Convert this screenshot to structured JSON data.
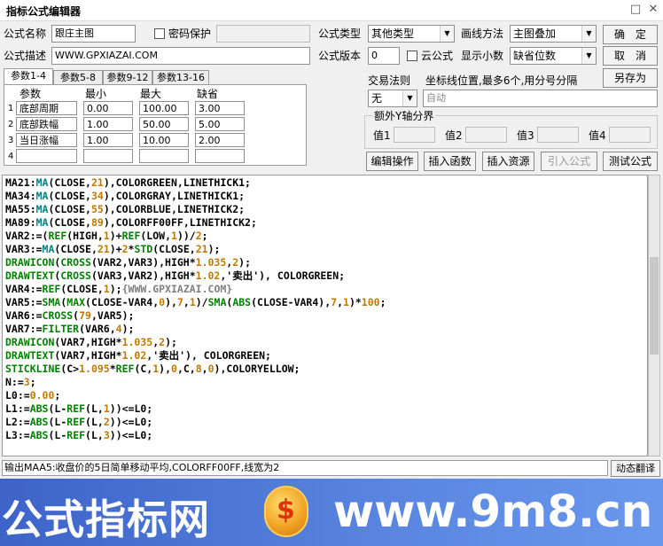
{
  "window": {
    "title": "指标公式编辑器",
    "restore_glyph": "□",
    "close_glyph": "✕"
  },
  "header": {
    "name_label": "公式名称",
    "name_value": "跟庄主图",
    "password_label": "密码保护",
    "desc_label": "公式描述",
    "desc_value": "WWW.GPXIAZAI.COM",
    "type_label": "公式类型",
    "type_value": "其他类型",
    "draw_label": "画线方法",
    "draw_value": "主图叠加",
    "version_label": "公式版本",
    "version_value": "0",
    "cloud_label": "云公式",
    "decimals_label": "显示小数",
    "decimals_value": "缺省位数",
    "ok_label": "确　定",
    "cancel_label": "取　消",
    "saveas_label": "另存为"
  },
  "params": {
    "tabs": [
      "参数1-4",
      "参数5-8",
      "参数9-12",
      "参数13-16"
    ],
    "columns": [
      "参数",
      "最小",
      "最大",
      "缺省"
    ],
    "rows": [
      {
        "idx": "1",
        "name": "底部周期",
        "min": "0.00",
        "max": "100.00",
        "def": "3.00"
      },
      {
        "idx": "2",
        "name": "底部跌幅",
        "min": "1.00",
        "max": "50.00",
        "def": "5.00"
      },
      {
        "idx": "3",
        "name": "当日涨幅",
        "min": "1.00",
        "max": "10.00",
        "def": "2.00"
      },
      {
        "idx": "4",
        "name": "",
        "min": "",
        "max": "",
        "def": ""
      }
    ]
  },
  "trade": {
    "rule_label": "交易法则",
    "rule_value": "无",
    "axis_label": "坐标线位置,最多6个,用分号分隔",
    "axis_value": "自动",
    "group_label": "额外Y轴分界",
    "values": [
      "值1",
      "值2",
      "值3",
      "值4"
    ]
  },
  "actions": [
    "编辑操作",
    "插入函数",
    "插入资源",
    "引入公式",
    "测试公式"
  ],
  "code_lines": [
    [
      [
        "MA21:",
        "tx"
      ],
      [
        "MA",
        "fn"
      ],
      [
        "(CLOSE,",
        "tx"
      ],
      [
        "21",
        "num"
      ],
      [
        "),COLORGREEN,LINETHICK1;",
        "tx"
      ]
    ],
    [
      [
        "MA34:",
        "tx"
      ],
      [
        "MA",
        "fn"
      ],
      [
        "(CLOSE,",
        "tx"
      ],
      [
        "34",
        "num"
      ],
      [
        "),COLORGRAY,LINETHICK1;",
        "tx"
      ]
    ],
    [
      [
        "MA55:",
        "tx"
      ],
      [
        "MA",
        "fn"
      ],
      [
        "(CLOSE,",
        "tx"
      ],
      [
        "55",
        "num"
      ],
      [
        "),COLORBLUE,LINETHICK2;",
        "tx"
      ]
    ],
    [
      [
        "MA89:",
        "tx"
      ],
      [
        "MA",
        "fn"
      ],
      [
        "(CLOSE,",
        "tx"
      ],
      [
        "89",
        "num"
      ],
      [
        "),COLORFF00FF,LINETHICK2;",
        "tx"
      ]
    ],
    [
      [
        "VAR2:=(",
        "tx"
      ],
      [
        "REF",
        "kw"
      ],
      [
        "(HIGH,",
        "tx"
      ],
      [
        "1",
        "num"
      ],
      [
        ")+",
        "tx"
      ],
      [
        "REF",
        "kw"
      ],
      [
        "(LOW,",
        "tx"
      ],
      [
        "1",
        "num"
      ],
      [
        "))/",
        "tx"
      ],
      [
        "2",
        "num"
      ],
      [
        ";",
        "tx"
      ]
    ],
    [
      [
        "VAR3:=",
        "tx"
      ],
      [
        "MA",
        "fn"
      ],
      [
        "(CLOSE,",
        "tx"
      ],
      [
        "21",
        "num"
      ],
      [
        ")+",
        "tx"
      ],
      [
        "2",
        "num"
      ],
      [
        "*",
        "tx"
      ],
      [
        "STD",
        "kw"
      ],
      [
        "(CLOSE,",
        "tx"
      ],
      [
        "21",
        "num"
      ],
      [
        ");",
        "tx"
      ]
    ],
    [
      [
        "DRAWICON",
        "kw"
      ],
      [
        "(",
        "tx"
      ],
      [
        "CROSS",
        "kw"
      ],
      [
        "(VAR2,VAR3),HIGH*",
        "tx"
      ],
      [
        "1.035",
        "num"
      ],
      [
        ",",
        "tx"
      ],
      [
        "2",
        "num"
      ],
      [
        ");",
        "tx"
      ]
    ],
    [
      [
        "DRAWTEXT",
        "kw"
      ],
      [
        "(",
        "tx"
      ],
      [
        "CROSS",
        "kw"
      ],
      [
        "(VAR3,VAR2),HIGH*",
        "tx"
      ],
      [
        "1.02",
        "num"
      ],
      [
        ",'卖出'), COLORGREEN;",
        "tx"
      ]
    ],
    [
      [
        "VAR4:=",
        "tx"
      ],
      [
        "REF",
        "kw"
      ],
      [
        "(CLOSE,",
        "tx"
      ],
      [
        "1",
        "num"
      ],
      [
        ");",
        "tx"
      ],
      [
        "{WWW.GPXIAZAI.COM}",
        "cm"
      ]
    ],
    [
      [
        "VAR5:=",
        "tx"
      ],
      [
        "SMA",
        "kw"
      ],
      [
        "(",
        "tx"
      ],
      [
        "MAX",
        "kw"
      ],
      [
        "(CLOSE-VAR4,",
        "tx"
      ],
      [
        "0",
        "num"
      ],
      [
        "),",
        "tx"
      ],
      [
        "7",
        "num"
      ],
      [
        ",",
        "tx"
      ],
      [
        "1",
        "num"
      ],
      [
        ")/",
        "tx"
      ],
      [
        "SMA",
        "kw"
      ],
      [
        "(",
        "tx"
      ],
      [
        "ABS",
        "kw"
      ],
      [
        "(CLOSE-VAR4),",
        "tx"
      ],
      [
        "7",
        "num"
      ],
      [
        ",",
        "tx"
      ],
      [
        "1",
        "num"
      ],
      [
        ")*",
        "tx"
      ],
      [
        "100",
        "num"
      ],
      [
        ";",
        "tx"
      ]
    ],
    [
      [
        "VAR6:=",
        "tx"
      ],
      [
        "CROSS",
        "kw"
      ],
      [
        "(",
        "tx"
      ],
      [
        "79",
        "num"
      ],
      [
        ",VAR5);",
        "tx"
      ]
    ],
    [
      [
        "VAR7:=",
        "tx"
      ],
      [
        "FILTER",
        "kw"
      ],
      [
        "(VAR6,",
        "tx"
      ],
      [
        "4",
        "num"
      ],
      [
        ");",
        "tx"
      ]
    ],
    [
      [
        "DRAWICON",
        "kw"
      ],
      [
        "(VAR7,HIGH*",
        "tx"
      ],
      [
        "1.035",
        "num"
      ],
      [
        ",",
        "tx"
      ],
      [
        "2",
        "num"
      ],
      [
        ");",
        "tx"
      ]
    ],
    [
      [
        "DRAWTEXT",
        "kw"
      ],
      [
        "(VAR7,HIGH*",
        "tx"
      ],
      [
        "1.02",
        "num"
      ],
      [
        ",'卖出'), COLORGREEN;",
        "tx"
      ]
    ],
    [
      [
        "STICKLINE",
        "kw"
      ],
      [
        "(C>",
        "tx"
      ],
      [
        "1.095",
        "num"
      ],
      [
        "*",
        "tx"
      ],
      [
        "REF",
        "kw"
      ],
      [
        "(C,",
        "tx"
      ],
      [
        "1",
        "num"
      ],
      [
        "),",
        "tx"
      ],
      [
        "0",
        "num"
      ],
      [
        ",C,",
        "tx"
      ],
      [
        "8",
        "num"
      ],
      [
        ",",
        "tx"
      ],
      [
        "0",
        "num"
      ],
      [
        "),COLORYELLOW;",
        "tx"
      ]
    ],
    [
      [
        "N:=",
        "tx"
      ],
      [
        "3",
        "num"
      ],
      [
        ";",
        "tx"
      ]
    ],
    [
      [
        "L0:=",
        "tx"
      ],
      [
        "0.00",
        "num"
      ],
      [
        ";",
        "tx"
      ]
    ],
    [
      [
        "L1:=",
        "tx"
      ],
      [
        "ABS",
        "kw"
      ],
      [
        "(L-",
        "tx"
      ],
      [
        "REF",
        "kw"
      ],
      [
        "(L,",
        "tx"
      ],
      [
        "1",
        "num"
      ],
      [
        "))<=L0;",
        "tx"
      ]
    ],
    [
      [
        "L2:=",
        "tx"
      ],
      [
        "ABS",
        "kw"
      ],
      [
        "(L-",
        "tx"
      ],
      [
        "REF",
        "kw"
      ],
      [
        "(L,",
        "tx"
      ],
      [
        "2",
        "num"
      ],
      [
        "))<=L0;",
        "tx"
      ]
    ],
    [
      [
        "L3:=",
        "tx"
      ],
      [
        "ABS",
        "kw"
      ],
      [
        "(L-",
        "tx"
      ],
      [
        "REF",
        "kw"
      ],
      [
        "(L,",
        "tx"
      ],
      [
        "3",
        "num"
      ],
      [
        "))<=L0;",
        "tx"
      ]
    ]
  ],
  "status": {
    "text": "输出MAA5:收盘价的5日简单移动平均,COLORFF00FF,线宽为2",
    "translate_label": "动态翻译"
  },
  "banner": {
    "left_text": "公式指标网",
    "coin_glyph": "$",
    "right_text": "www.9m8.cn"
  }
}
